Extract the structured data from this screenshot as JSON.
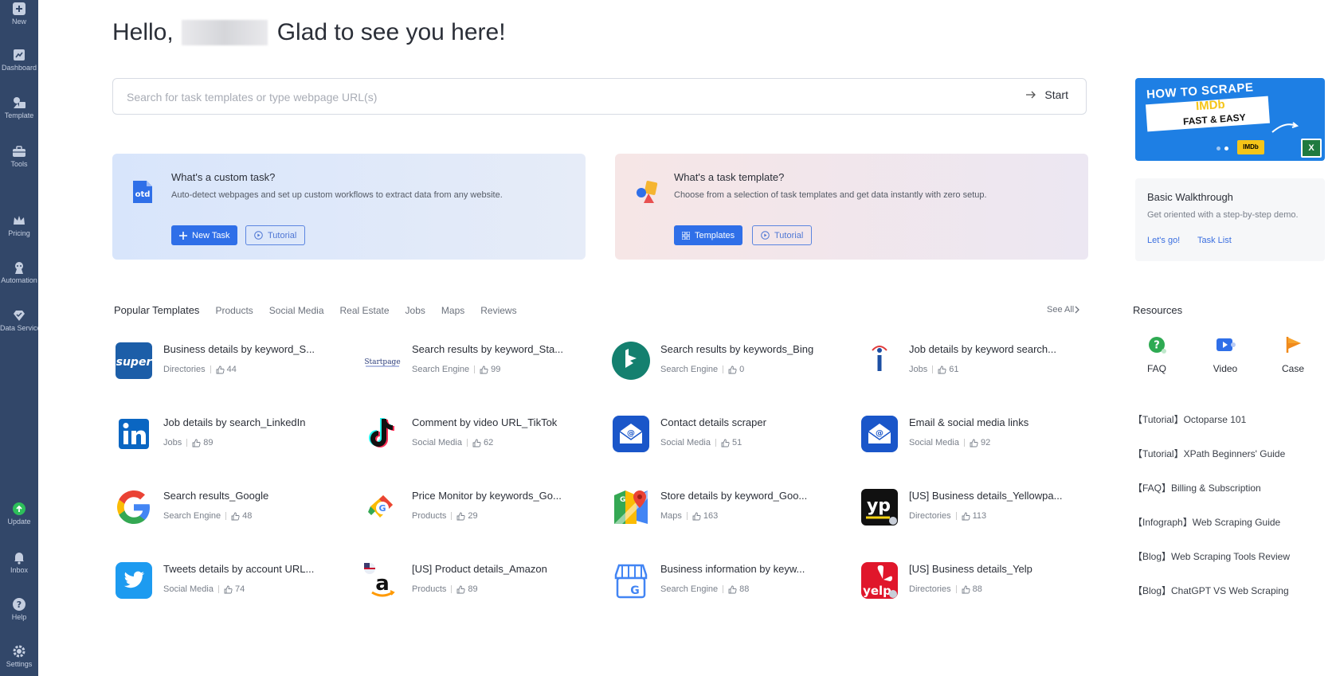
{
  "sidebar": {
    "items": [
      {
        "label": "New",
        "icon": "plus-square-icon"
      },
      {
        "label": "Dashboard",
        "icon": "dashboard-icon"
      },
      {
        "label": "Template",
        "icon": "template-icon"
      },
      {
        "label": "Tools",
        "icon": "toolbox-icon"
      },
      {
        "label": "Pricing",
        "icon": "crown-icon"
      },
      {
        "label": "Automation",
        "icon": "robot-icon"
      },
      {
        "label": "Data Service",
        "icon": "diamond-icon"
      },
      {
        "label": "Update",
        "icon": "update-icon"
      },
      {
        "label": "Inbox",
        "icon": "bell-icon"
      },
      {
        "label": "Help",
        "icon": "help-icon"
      },
      {
        "label": "Settings",
        "icon": "gear-icon"
      }
    ]
  },
  "greeting": {
    "prefix": "Hello,",
    "suffix": "Glad to see you here!"
  },
  "search": {
    "placeholder": "Search for task templates or type webpage URL(s)",
    "start_label": "Start"
  },
  "cards": {
    "custom": {
      "title": "What's a custom task?",
      "description": "Auto-detect webpages and set up custom workflows to extract data from any website.",
      "primary_label": "New Task",
      "tutorial_label": "Tutorial"
    },
    "template": {
      "title": "What's a task template?",
      "description": "Choose from a selection of task templates and get data instantly with zero setup.",
      "primary_label": "Templates",
      "tutorial_label": "Tutorial"
    }
  },
  "promo": {
    "line1": "HOW TO SCRAPE",
    "brand": "IMDb",
    "line2": "FAST & EASY",
    "badge": "IMDb",
    "xl": "X"
  },
  "walkthrough": {
    "title": "Basic Walkthrough",
    "description": "Get oriented with a step-by-step demo.",
    "lets_go": "Let's go!",
    "task_list": "Task List"
  },
  "popular": {
    "tabs": [
      "Popular Templates",
      "Products",
      "Social Media",
      "Real Estate",
      "Jobs",
      "Maps",
      "Reviews"
    ],
    "see_all": "See All",
    "templates": [
      {
        "title": "Business details by keyword_S...",
        "category": "Directories",
        "likes": "44",
        "icon": "superpages-icon"
      },
      {
        "title": "Search results by keyword_Sta...",
        "category": "Search Engine",
        "likes": "99",
        "icon": "startpage-icon"
      },
      {
        "title": "Search results by keywords_Bing",
        "category": "Search Engine",
        "likes": "0",
        "icon": "bing-icon"
      },
      {
        "title": "Job details by keyword search...",
        "category": "Jobs",
        "likes": "61",
        "icon": "info-icon"
      },
      {
        "title": "Job details by search_LinkedIn",
        "category": "Jobs",
        "likes": "89",
        "icon": "linkedin-icon"
      },
      {
        "title": "Comment by video URL_TikTok",
        "category": "Social Media",
        "likes": "62",
        "icon": "tiktok-icon"
      },
      {
        "title": "Contact details scraper",
        "category": "Social Media",
        "likes": "51",
        "icon": "email-icon"
      },
      {
        "title": "Email & social media links",
        "category": "Social Media",
        "likes": "92",
        "icon": "email-icon"
      },
      {
        "title": "Search results_Google",
        "category": "Search Engine",
        "likes": "48",
        "icon": "google-icon"
      },
      {
        "title": "Price Monitor by keywords_Go...",
        "category": "Products",
        "likes": "29",
        "icon": "google-shopping-icon"
      },
      {
        "title": "Store details by keyword_Goo...",
        "category": "Maps",
        "likes": "163",
        "icon": "google-maps-icon"
      },
      {
        "title": "[US] Business details_Yellowpa...",
        "category": "Directories",
        "likes": "113",
        "icon": "yellowpages-icon"
      },
      {
        "title": "Tweets details by account URL...",
        "category": "Social Media",
        "likes": "74",
        "icon": "twitter-icon"
      },
      {
        "title": "[US] Product details_Amazon",
        "category": "Products",
        "likes": "89",
        "icon": "amazon-icon"
      },
      {
        "title": "Business information by keyw...",
        "category": "Search Engine",
        "likes": "88",
        "icon": "google-business-icon"
      },
      {
        "title": "[US] Business details_Yelp",
        "category": "Directories",
        "likes": "88",
        "icon": "yelp-icon"
      }
    ]
  },
  "resources": {
    "title": "Resources",
    "icons": [
      {
        "label": "FAQ",
        "icon": "faq-icon"
      },
      {
        "label": "Video",
        "icon": "video-icon"
      },
      {
        "label": "Case",
        "icon": "case-icon"
      }
    ],
    "links": [
      "【Tutorial】Octoparse 101",
      "【Tutorial】XPath Beginners' Guide",
      "【FAQ】Billing & Subscription",
      "【Infograph】Web Scraping Guide",
      "【Blog】Web Scraping Tools Review",
      "【Blog】ChatGPT VS Web Scraping"
    ]
  },
  "colors": {
    "sidebar": "#324769",
    "accent": "#2f6fe8"
  }
}
